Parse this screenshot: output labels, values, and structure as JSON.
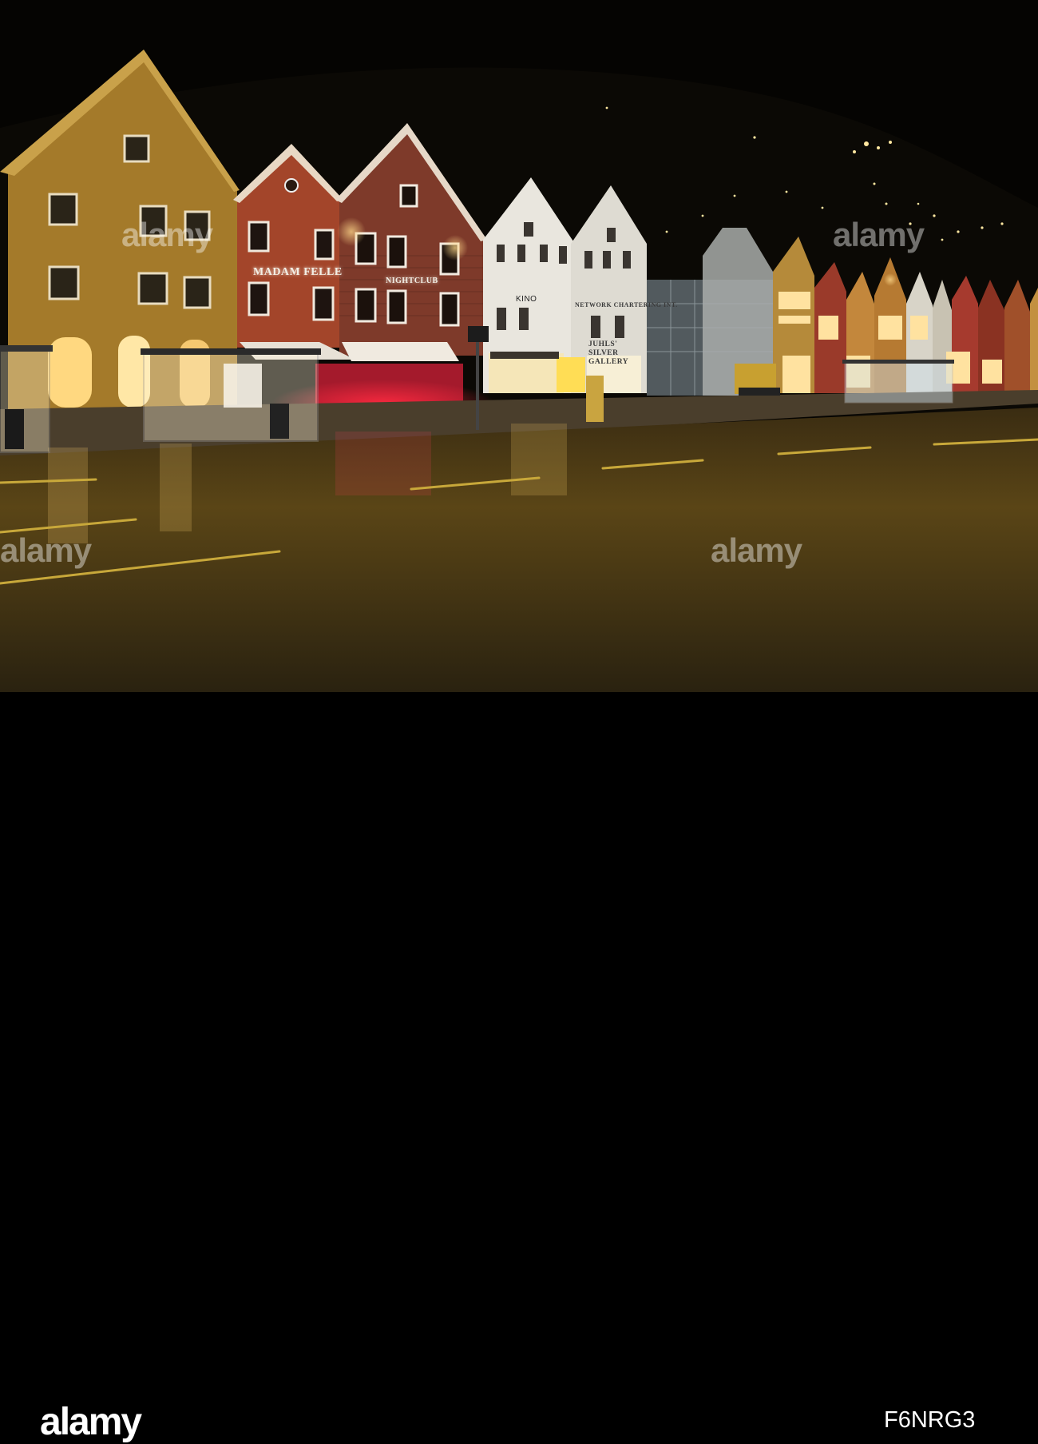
{
  "scene": {
    "signs": {
      "madam_felle": "MADAM FELLE",
      "nightclub": "NIGHTCLUB",
      "kino": "KINO",
      "network": "NETWORK CHARTERING INT.",
      "juhls": "JUHLS' SILVER GALLERY"
    },
    "watermark": "alamy"
  },
  "footer": {
    "logo": "alamy",
    "image_code": "F6NRG3"
  }
}
